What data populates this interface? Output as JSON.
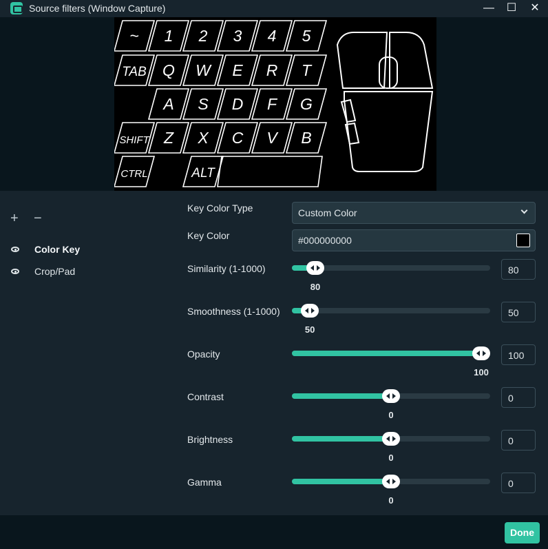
{
  "window": {
    "title": "Source filters (Window Capture)",
    "icon": "streamlabs-app-icon"
  },
  "window_controls": {
    "minimize": "—",
    "maximize": "☐",
    "close": "✕"
  },
  "preview": {
    "keys": [
      [
        "~",
        "1",
        "2",
        "3",
        "4",
        "5"
      ],
      [
        "TAB",
        "Q",
        "W",
        "E",
        "R",
        "T"
      ],
      [
        "A",
        "S",
        "D",
        "F",
        "G"
      ],
      [
        "SHIFT",
        "Z",
        "X",
        "C",
        "V",
        "B"
      ],
      [
        "CTRL",
        "ALT"
      ]
    ]
  },
  "toolbar": {
    "add": "+",
    "remove": "−"
  },
  "filters": [
    {
      "name": "Color Key",
      "active": true
    },
    {
      "name": "Crop/Pad",
      "active": false
    }
  ],
  "settings": {
    "key_color_type": {
      "label": "Key Color Type",
      "value": "Custom Color"
    },
    "key_color": {
      "label": "Key Color",
      "value": "#000000000",
      "swatch": "#000000"
    },
    "sliders": [
      {
        "label": "Similarity (1-1000)",
        "value": "80",
        "fraction": 0.08
      },
      {
        "label": "Smoothness (1-1000)",
        "value": "50",
        "fraction": 0.05
      },
      {
        "label": "Opacity",
        "value": "100",
        "fraction": 1.0
      },
      {
        "label": "Contrast",
        "value": "0",
        "fraction": 0.5
      },
      {
        "label": "Brightness",
        "value": "0",
        "fraction": 0.5
      },
      {
        "label": "Gamma",
        "value": "0",
        "fraction": 0.5
      }
    ]
  },
  "footer": {
    "done": "Done"
  },
  "colors": {
    "accent": "#31c3a2",
    "background": "#17242d",
    "dark": "#09161d"
  }
}
